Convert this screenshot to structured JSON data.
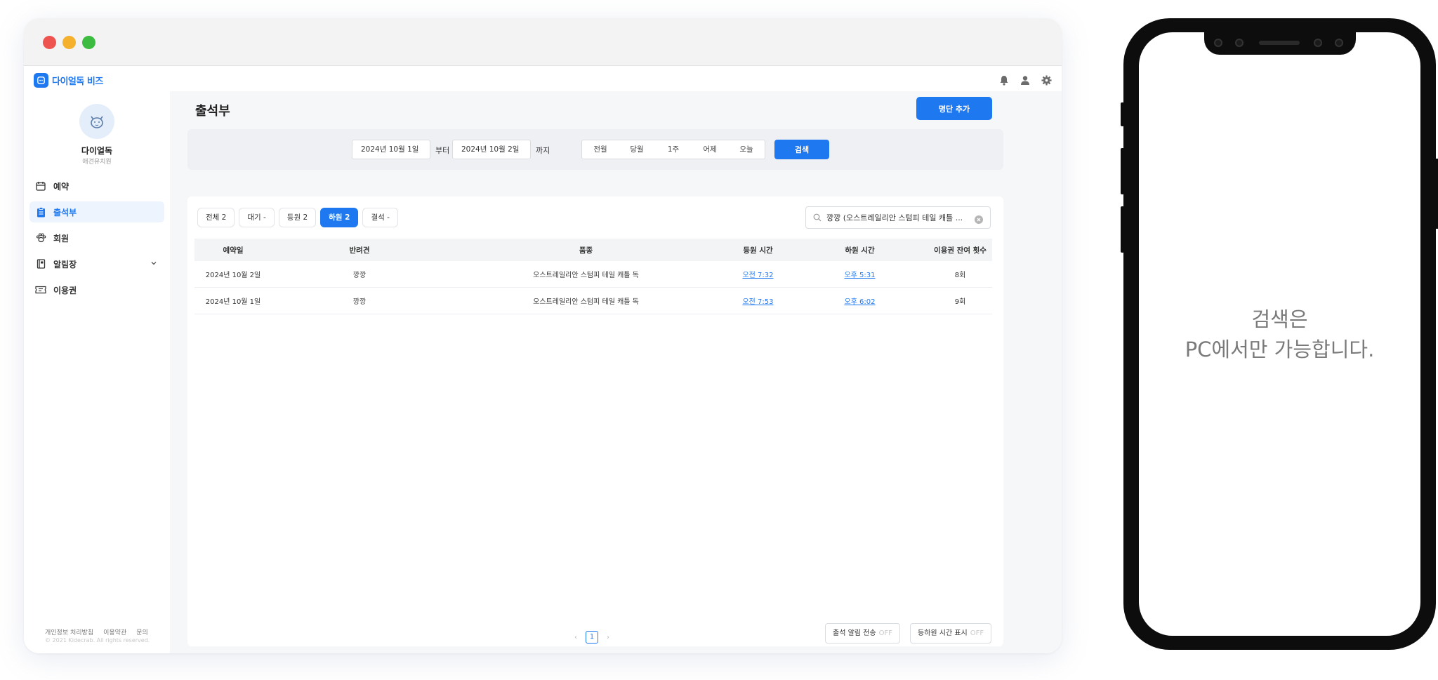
{
  "app": {
    "logo_text": "다이얼독 비즈",
    "brand_color": "#1e78f0",
    "top_icons": [
      "bell-icon",
      "user-icon",
      "gear-icon"
    ]
  },
  "sidebar": {
    "profile": {
      "name": "다이얼독",
      "subtitle": "애견유치원"
    },
    "items": [
      {
        "label": "예약",
        "icon": "calendar-icon",
        "active": false
      },
      {
        "label": "출석부",
        "icon": "clipboard-icon",
        "active": true
      },
      {
        "label": "회원",
        "icon": "paw-icon",
        "active": false
      },
      {
        "label": "알림장",
        "icon": "notebook-icon",
        "active": false,
        "expandable": true
      },
      {
        "label": "이용권",
        "icon": "ticket-icon",
        "active": false
      }
    ],
    "footer_links": [
      "개인정보 처리방침",
      "이용약관",
      "문의"
    ],
    "copyright": "© 2021 Kidecrab. All rights reserved."
  },
  "main": {
    "title": "출석부",
    "add_button": "명단 추가",
    "filter": {
      "date_from": "2024년 10월 1일",
      "from_suffix": "부터",
      "date_to": "2024년 10월 2일",
      "to_suffix": "까지",
      "quick_ranges": [
        "전월",
        "당월",
        "1주",
        "어제",
        "오늘"
      ],
      "search_button": "검색"
    },
    "tabs": [
      {
        "label": "전체 2",
        "active": false
      },
      {
        "label": "대기 -",
        "active": false
      },
      {
        "label": "등원 2",
        "active": false
      },
      {
        "label": "하원 2",
        "active": true
      },
      {
        "label": "결석 -",
        "active": false
      }
    ],
    "search_value": "깡깡 (오스트레일리안 스텀피 테일 캐틀 ...",
    "table": {
      "headers": [
        "예약일",
        "반려견",
        "품종",
        "등원 시간",
        "하원 시간",
        "이용권 잔여 횟수"
      ],
      "rows": [
        {
          "date": "2024년 10월 2일",
          "dog": "깡깡",
          "breed": "오스트레일리안 스텀피 테일 캐틀 독",
          "checkin": "오전 7:32",
          "checkout": "오후 5:31",
          "remaining": "8회"
        },
        {
          "date": "2024년 10월 1일",
          "dog": "깡깡",
          "breed": "오스트레일리안 스텀피 테일 캐틀 독",
          "checkin": "오전 7:53",
          "checkout": "오후 6:02",
          "remaining": "9회"
        }
      ]
    },
    "pagination": {
      "current": "1",
      "prev": "‹",
      "next": "›"
    },
    "toggles": [
      {
        "label": "출석 알림 전송",
        "state": "OFF"
      },
      {
        "label": "등하원 시간 표시",
        "state": "OFF"
      }
    ]
  },
  "phone": {
    "message_line1": "검색은",
    "message_line2": "PC에서만 가능합니다."
  }
}
